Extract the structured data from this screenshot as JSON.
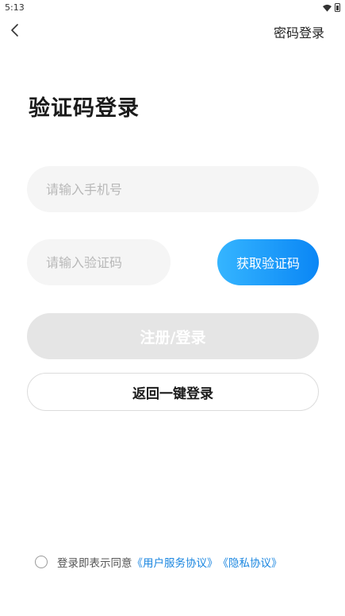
{
  "status_bar": {
    "time": "5:13"
  },
  "nav": {
    "password_login_label": "密码登录"
  },
  "page_title": "验证码登录",
  "phone": {
    "placeholder": "请输入手机号"
  },
  "code": {
    "placeholder": "请输入验证码",
    "get_code_label": "获取验证码"
  },
  "register_login_label": "注册/登录",
  "one_click_label": "返回一键登录",
  "agreement": {
    "prefix": "登录即表示同意",
    "user_agreement": "《用户服务协议》",
    "privacy_agreement": "《隐私协议》"
  },
  "colors": {
    "accent_start": "#35b5ff",
    "accent_end": "#0a86f5",
    "link": "#1a86e0",
    "disabled_button": "#e5e5e5"
  },
  "icons": [
    "wifi-icon",
    "battery-icon",
    "back-arrow-icon"
  ]
}
